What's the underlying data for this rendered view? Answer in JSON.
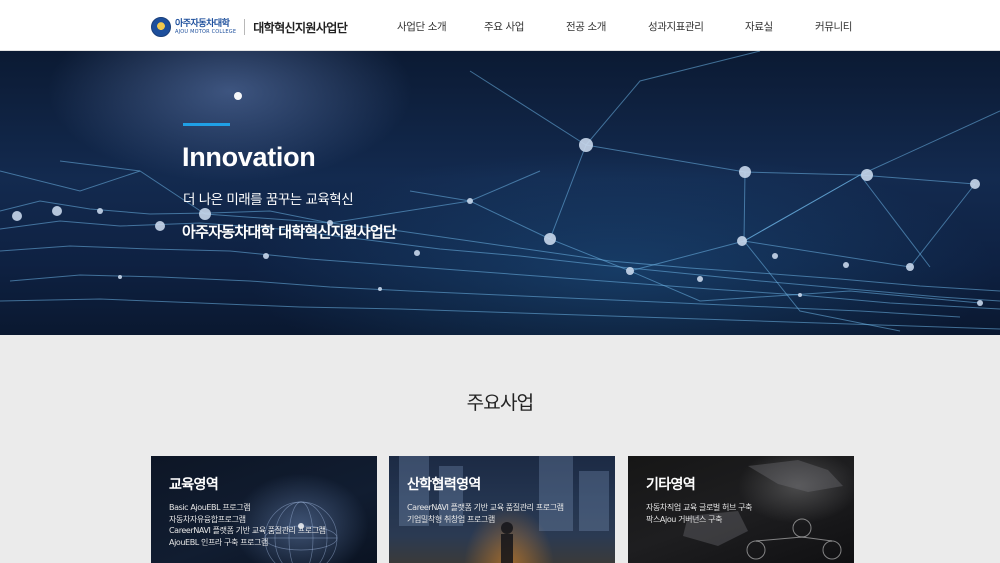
{
  "header": {
    "logo_kr": "아주자동차대학",
    "logo_en": "AJOU MOTOR COLLEGE",
    "site_title": "대학혁신지원사업단",
    "nav": [
      "사업단 소개",
      "주요 사업",
      "전공 소개",
      "성과지표관리",
      "자료실",
      "커뮤니티"
    ]
  },
  "hero": {
    "heading": "Innovation",
    "subtitle": "더 나은 미래를 꿈꾸는 교육혁신",
    "tagline": "아주자동차대학 대학혁신지원사업단"
  },
  "section": {
    "title": "주요사업"
  },
  "cards": [
    {
      "title": "교육영역",
      "lines": [
        "Basic AjouEBL 프로그램",
        "자동차자유융합프로그램",
        "CareerNAVI 플랫폼 기반 교육 품질관리 프로그램",
        "AjouEBL 인프라 구축 프로그램"
      ]
    },
    {
      "title": "산학협력영역",
      "lines": [
        "CareerNAVI 플랫폼 기반 교육 품질관리 프로그램",
        "기업밀착형 취창업 프로그램"
      ]
    },
    {
      "title": "기타영역",
      "lines": [
        "자동차직업 교육 글로벌 허브 구축",
        "팍스Ajou 거버넌스 구축"
      ]
    }
  ],
  "colors": {
    "accent": "#1fa0e6",
    "header_bg": "#ffffff",
    "section_bg": "#ebebeb",
    "hero_bg": "#0e2142"
  },
  "icons": [
    "college-emblem-icon"
  ]
}
